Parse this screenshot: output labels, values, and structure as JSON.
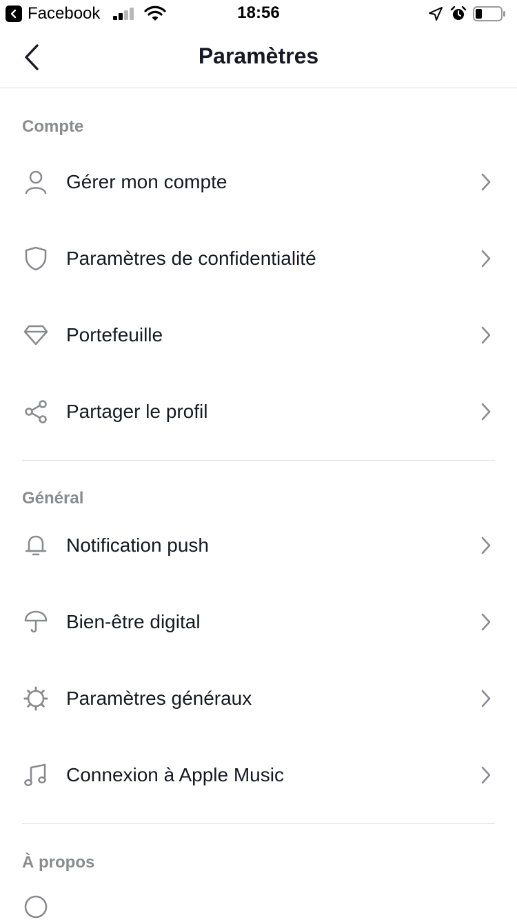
{
  "status_bar": {
    "app": "Facebook",
    "time": "18:56",
    "icons": [
      "back-to-app-icon",
      "signal-icon",
      "wifi-icon",
      "location-icon",
      "alarm-icon",
      "battery-icon"
    ]
  },
  "nav": {
    "title": "Paramètres",
    "back_icon": "chevron-left-icon"
  },
  "sections": [
    {
      "title": "Compte",
      "items": [
        {
          "label": "Gérer mon compte",
          "icon": "person-icon"
        },
        {
          "label": "Paramètres de confidentialité",
          "icon": "shield-icon"
        },
        {
          "label": "Portefeuille",
          "icon": "diamond-icon"
        },
        {
          "label": "Partager le profil",
          "icon": "share-icon"
        }
      ]
    },
    {
      "title": "Général",
      "items": [
        {
          "label": "Notification push",
          "icon": "bell-icon"
        },
        {
          "label": "Bien-être digital",
          "icon": "umbrella-icon"
        },
        {
          "label": "Paramètres généraux",
          "icon": "gear-icon"
        },
        {
          "label": "Connexion à Apple Music",
          "icon": "music-note-icon"
        }
      ]
    },
    {
      "title": "À propos",
      "items": []
    }
  ],
  "colors": {
    "text": "#161823",
    "section_header": "#8a8b91",
    "icon": "#8a8b91",
    "divider": "#dedede"
  }
}
